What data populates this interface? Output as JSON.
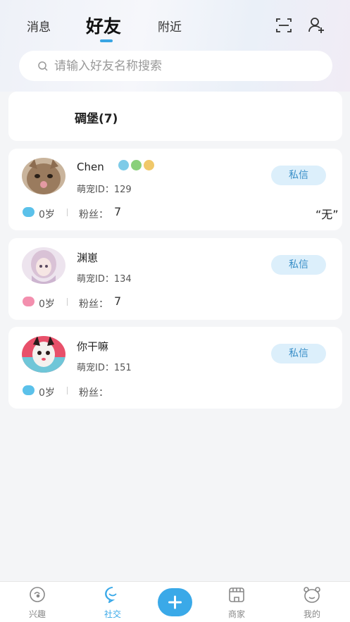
{
  "header": {
    "tabs": [
      {
        "label": "消息"
      },
      {
        "label": "好友"
      },
      {
        "label": "附近"
      }
    ]
  },
  "search": {
    "placeholder": "请输入好友名称搜索"
  },
  "group": {
    "title": "碉堡(7)"
  },
  "friends": [
    {
      "name": "Chen",
      "id_text": "萌宠ID：129",
      "age": "0岁",
      "fans_label": "粉丝：",
      "fans": "7",
      "note": "“无”",
      "gender": "male",
      "action": "私信"
    },
    {
      "name": "渊崽",
      "id_text": "萌宠ID：134",
      "age": "0岁",
      "fans_label": "粉丝：",
      "fans": "7",
      "note": "",
      "gender": "female",
      "action": "私信"
    },
    {
      "name": "你干嘛",
      "id_text": "萌宠ID：151",
      "age": "0岁",
      "fans_label": "粉丝：",
      "fans": "",
      "note": "",
      "gender": "male",
      "action": "私信"
    }
  ],
  "bottom_nav": [
    {
      "label": "兴趣",
      "icon": "interest-icon"
    },
    {
      "label": "社交",
      "icon": "social-icon"
    },
    {
      "label": "",
      "icon": "plus-icon"
    },
    {
      "label": "商家",
      "icon": "shop-icon"
    },
    {
      "label": "我的",
      "icon": "profile-icon"
    }
  ],
  "colors": {
    "accent": "#3aa9e8",
    "pm_bg": "#dceffb",
    "male": "#5bc1ea",
    "female": "#f38fae"
  }
}
